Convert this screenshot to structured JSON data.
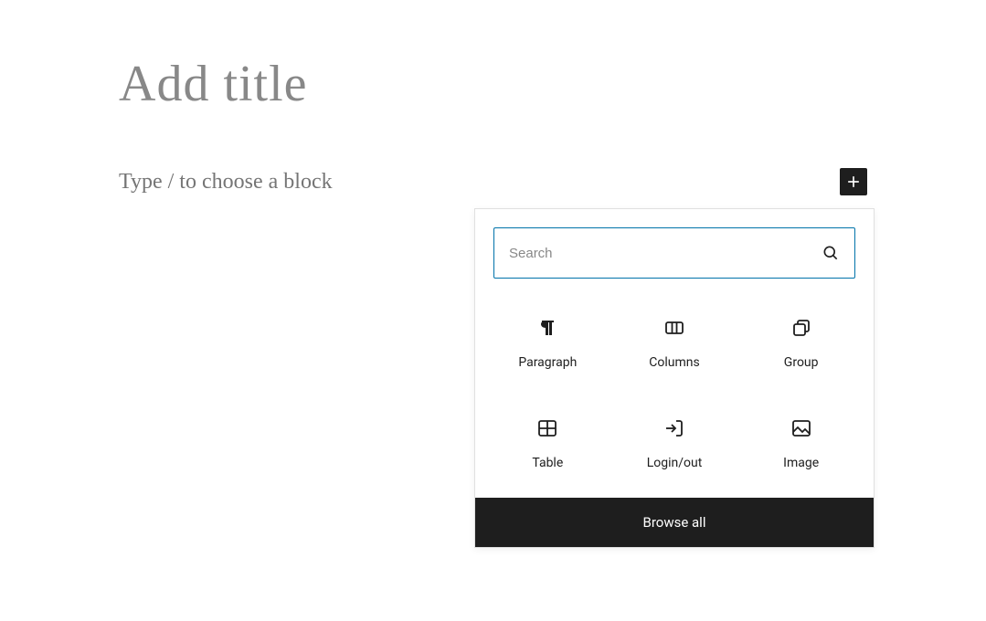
{
  "editor": {
    "title_placeholder": "Add title",
    "block_prompt": "Type / to choose a block"
  },
  "inserter": {
    "search_placeholder": "Search",
    "blocks": [
      {
        "label": "Paragraph",
        "icon_name": "paragraph-icon"
      },
      {
        "label": "Columns",
        "icon_name": "columns-icon"
      },
      {
        "label": "Group",
        "icon_name": "group-icon"
      },
      {
        "label": "Table",
        "icon_name": "table-icon"
      },
      {
        "label": "Login/out",
        "icon_name": "login-icon"
      },
      {
        "label": "Image",
        "icon_name": "image-icon"
      }
    ],
    "browse_all_label": "Browse all"
  },
  "colors": {
    "accent": "#0073aa",
    "dark": "#1e1e1e"
  }
}
